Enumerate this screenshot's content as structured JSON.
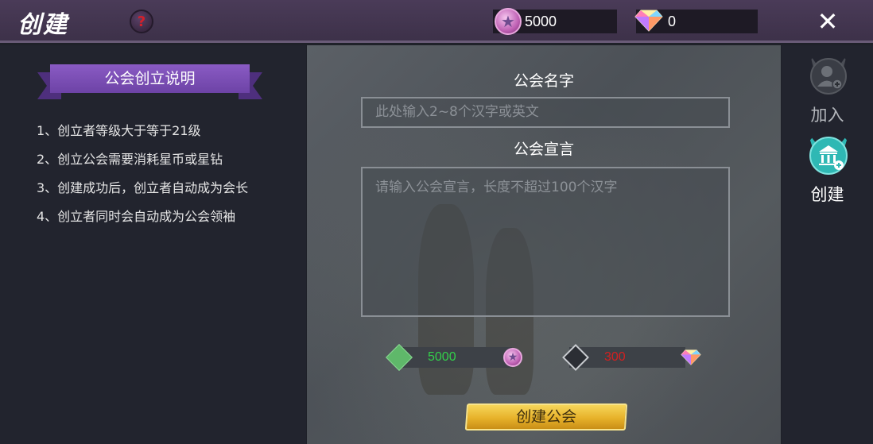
{
  "header": {
    "title": "创建",
    "help_icon_text": "?",
    "star_currency": "5000",
    "gem_currency": "0",
    "close_icon_text": "✕"
  },
  "rules_panel": {
    "title": "公会创立说明",
    "rules": [
      "1、创立者等级大于等于21级",
      "2、创立公会需要消耗星币或星钻",
      "3、创建成功后，创立者自动成为会长",
      "4、创立者同时会自动成为公会领袖"
    ]
  },
  "form": {
    "name_label": "公会名字",
    "name_placeholder": "此处输入2~8个汉字或英文",
    "declaration_label": "公会宣言",
    "declaration_placeholder": "请输入公会宣言，长度不超过100个汉字",
    "star_cost": "5000",
    "gem_cost": "300",
    "create_button": "创建公会"
  },
  "side_tabs": [
    {
      "label": "加入",
      "icon": "person-add-icon",
      "active": false
    },
    {
      "label": "创建",
      "icon": "guild-hall-add-icon",
      "active": true
    }
  ],
  "colors": {
    "accent_purple": "#7a4fb8",
    "star_cost_green": "#33d04a",
    "gem_cost_red": "#d42020",
    "active_tab_teal": "#2fb8b4",
    "button_gold": "#e7b22a"
  }
}
